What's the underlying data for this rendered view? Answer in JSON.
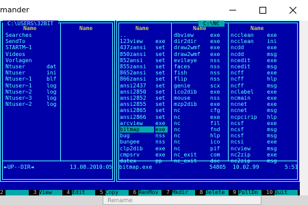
{
  "window": {
    "title": "mander"
  },
  "left_panel": {
    "path": " C:\\USERS\\32BIT ",
    "col_headers": [
      "Name",
      "Name"
    ],
    "col1": [
      {
        "name": "Searches"
      },
      {
        "name": "SendTo"
      },
      {
        "name": "STARTM~1"
      },
      {
        "name": "Videos"
      },
      {
        "name": "Vorlagen"
      },
      {
        "name": "Ntuser",
        "ext": "dat"
      },
      {
        "name": "Ntuser",
        "ext": "ini"
      },
      {
        "name": "Ntuser~1",
        "ext": "blf"
      },
      {
        "name": "Ntuser~1",
        "ext": "log"
      },
      {
        "name": "Ntuser~2",
        "ext": "log"
      },
      {
        "name": "Ntuser~3",
        "ext": "log"
      },
      {
        "name": "Ntuser~2",
        "ext": "log"
      }
    ],
    "status": {
      "name": "►UP--DIR◄",
      "date": "13.08.20",
      "time": "10:05"
    }
  },
  "right_panel": {
    "path": " C:\\NC ",
    "col_headers": [
      "Name",
      "Name",
      "Name"
    ],
    "col1": [
      {
        "name": ".."
      },
      {
        "name": "123view",
        "ext": "exe"
      },
      {
        "name": "437zansi",
        "ext": "set"
      },
      {
        "name": "850zansi",
        "ext": "set"
      },
      {
        "name": "852ansi",
        "ext": "set"
      },
      {
        "name": "855zansi",
        "ext": "set"
      },
      {
        "name": "8652ansi",
        "ext": "set"
      },
      {
        "name": "866zansi",
        "ext": "set"
      },
      {
        "name": "ansi2437",
        "ext": "set"
      },
      {
        "name": "ansi2850",
        "ext": "set"
      },
      {
        "name": "ansi2852",
        "ext": "set"
      },
      {
        "name": "ansi2855",
        "ext": "set"
      },
      {
        "name": "ansi2865",
        "ext": "set"
      },
      {
        "name": "ansi2866",
        "ext": "set"
      },
      {
        "name": "arcview",
        "ext": "exe"
      },
      {
        "name": "bitmap",
        "ext": "exe"
      },
      {
        "name": "bug",
        "ext": "nss"
      },
      {
        "name": "bungee",
        "ext": "nss"
      },
      {
        "name": "clp2dib",
        "ext": "exe"
      },
      {
        "name": "cmpsrv",
        "ext": "exe"
      },
      {
        "name": "datex",
        "ext": "pp"
      }
    ],
    "col2": [
      {
        "name": "dbview",
        "ext": "exe"
      },
      {
        "name": "dir2dir",
        "ext": "exe"
      },
      {
        "name": "draw2wmf",
        "ext": "exe"
      },
      {
        "name": "draw2wmf",
        "ext": "exe"
      },
      {
        "name": "evileye",
        "ext": "nss"
      },
      {
        "name": "faces",
        "ext": "nss"
      },
      {
        "name": "fish",
        "ext": "nss"
      },
      {
        "name": "flip",
        "ext": "nss"
      },
      {
        "name": "genie",
        "ext": "scx"
      },
      {
        "name": "ico2dib",
        "ext": "exe"
      },
      {
        "name": "mouse",
        "ext": "nss"
      },
      {
        "name": "mzp2dib",
        "ext": "exe"
      },
      {
        "name": "nc",
        "ext": "cfg"
      },
      {
        "name": "nc",
        "ext": "exe"
      },
      {
        "name": "nc",
        "ext": "fil"
      },
      {
        "name": "nc",
        "ext": "fnd"
      },
      {
        "name": "nc",
        "ext": "hlp"
      },
      {
        "name": "nc",
        "ext": "ico"
      },
      {
        "name": "nc",
        "ext": "pif"
      },
      {
        "name": "nc_exit",
        "ext": "com"
      },
      {
        "name": "nc_exit",
        "ext": "doc"
      }
    ],
    "col3": [
      {
        "name": "ncclean",
        "ext": "exe"
      },
      {
        "name": "ncclean",
        "ext": "ini"
      },
      {
        "name": "ncdd",
        "ext": "exe"
      },
      {
        "name": "ncdd",
        "ext": "msg"
      },
      {
        "name": "ncedit",
        "ext": "exe"
      },
      {
        "name": "ncedit",
        "ext": "msg"
      },
      {
        "name": "ncff",
        "ext": "exe"
      },
      {
        "name": "ncff",
        "ext": "hlp"
      },
      {
        "name": "ncff",
        "ext": "msg"
      },
      {
        "name": "nclabel",
        "ext": "exe"
      },
      {
        "name": "ncmain",
        "ext": "exe"
      },
      {
        "name": "ncnet",
        "ext": "exe"
      },
      {
        "name": "ncnet",
        "ext": "msg"
      },
      {
        "name": "ncpcirip",
        "ext": "hlp"
      },
      {
        "name": "ncsf",
        "ext": "exe"
      },
      {
        "name": "ncsf",
        "ext": "msg"
      },
      {
        "name": "ncsf",
        "ext": "msg"
      },
      {
        "name": "ncsi",
        "ext": "exe"
      },
      {
        "name": "ncview",
        "ext": "msg"
      },
      {
        "name": "nc2zip",
        "ext": "exe"
      },
      {
        "name": "nc2zip",
        "ext": "msg"
      }
    ],
    "selected_index": 15,
    "status": {
      "name": "bitmap.exe",
      "size": "54805",
      "date": "10.02.99",
      "time": "5:51"
    }
  },
  "keybar": [
    {
      "num": "2",
      "label": ""
    },
    {
      "num": "3",
      "label": "View"
    },
    {
      "num": "4",
      "label": "Edit"
    },
    {
      "num": "5",
      "label": "Copy"
    },
    {
      "num": "6",
      "label": "RenMov"
    },
    {
      "num": "7",
      "label": "Mkdir"
    },
    {
      "num": "8",
      "label": "Delete"
    },
    {
      "num": "9",
      "label": "PullDn"
    },
    {
      "num": "10",
      "label": "Quit"
    }
  ],
  "taskbar": {
    "rename_label": "Rename"
  },
  "colors": {
    "panel_bg": "#0000a8",
    "text": "#55ffff",
    "header": "#ffff55",
    "selection": "#00aaaa"
  }
}
